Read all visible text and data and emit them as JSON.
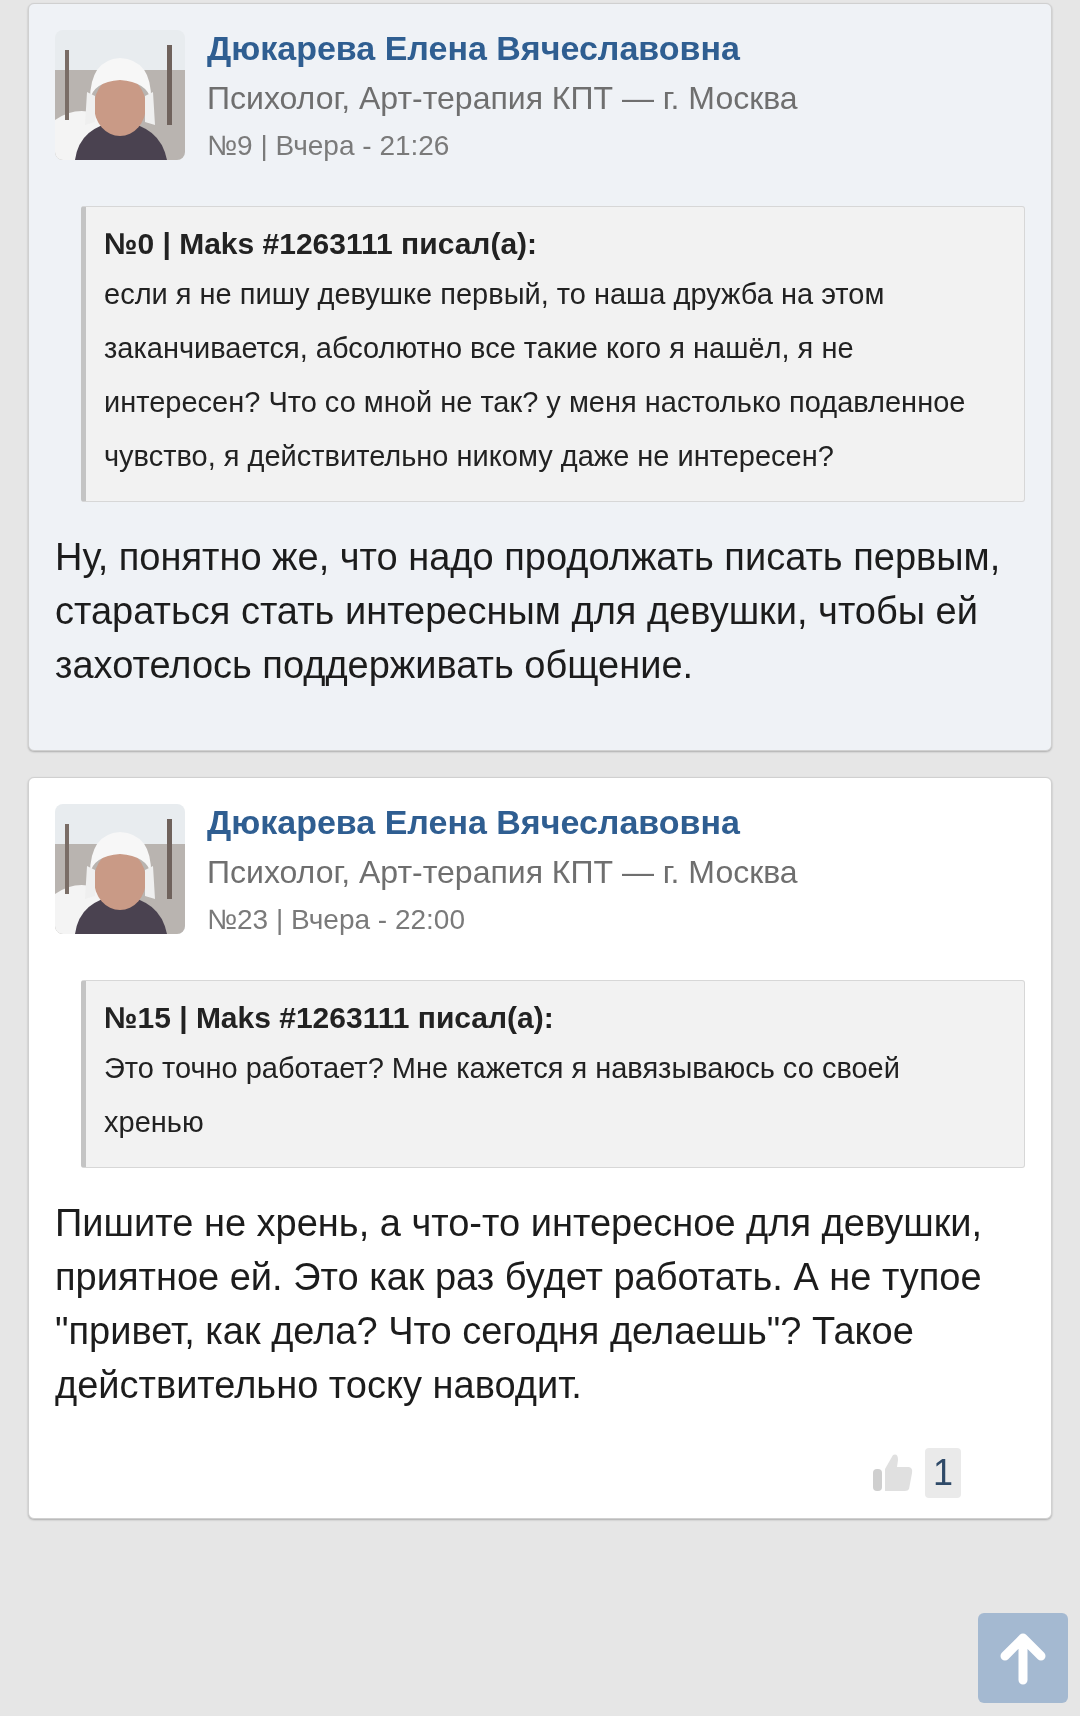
{
  "posts": [
    {
      "highlighted": true,
      "author": "Дюкарева Елена Вячеславовна",
      "subtitle": "Психолог, Арт-терапия КПТ — г. Москва",
      "meta": "№9 | Вчера - 21:26",
      "quote": {
        "header": "№0 | Maks #1263111 писал(а):",
        "text": "если я не пишу девушке первый, то наша дружба на этом заканчивается, абсолютно все такие кого я нашёл, я не интересен? Что со мной не так? у меня настолько подавленное чувство, я действительно никому даже не интересен?"
      },
      "body": "Ну, понятно же, что надо продолжать писать первым, стараться стать интересным для девушки, чтобы ей захотелось поддерживать общение."
    },
    {
      "highlighted": false,
      "author": "Дюкарева Елена Вячеславовна",
      "subtitle": "Психолог, Арт-терапия КПТ — г. Москва",
      "meta": "№23 | Вчера - 22:00",
      "quote": {
        "header": "№15 | Maks #1263111 писал(а):",
        "text": "Это точно работает? Мне кажется я навязываюсь со своей хренью"
      },
      "body": "Пишите не хрень, а что-то интересное для девушки, приятное ей. Это как раз будет работать. А не тупое \"привет, как дела? Что сегодня делаешь\"? Такое действительно тоску наводит.",
      "likes": "1"
    }
  ]
}
